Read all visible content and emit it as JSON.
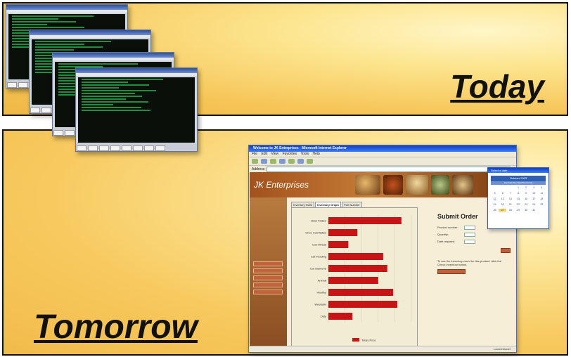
{
  "panels": {
    "top_label": "Today",
    "bottom_label": "Tomorrow"
  },
  "colors": {
    "panel_gold": "#f6c558",
    "terminal_text": "#1f8f3f",
    "bar_red": "#c81414",
    "banner_brown": "#a2521c"
  },
  "browser": {
    "window_title": "Welcome to JK Enterprises - Microsoft Internet Explorer",
    "menu": "File Edit View Favorites Tools Help",
    "address_label": "Address",
    "site_title": "JK Enterprises",
    "tabs": [
      "Inventory Table",
      "Inventory Graph",
      "Part Number"
    ],
    "form": {
      "heading": "Submit Order",
      "product_label": "Product number:",
      "quantity_label": "Quantity:",
      "date_label": "Date required:",
      "note": "To see the inventory count for this product, click the Check Inventory button."
    },
    "status_right": "Local intranet"
  },
  "datepicker": {
    "title": "Select a date...",
    "month": "October 2003",
    "weekdays": [
      "Sun",
      "Mon",
      "Tue",
      "Wed",
      "Thu",
      "Fri",
      "Sat"
    ],
    "days": [
      "",
      "",
      "",
      "1",
      "2",
      "3",
      "4",
      "5",
      "6",
      "7",
      "8",
      "9",
      "10",
      "11",
      "12",
      "13",
      "14",
      "15",
      "16",
      "17",
      "18",
      "19",
      "20",
      "21",
      "22",
      "23",
      "24",
      "25",
      "26",
      "27",
      "28",
      "29",
      "30",
      "31"
    ],
    "selected_day": "27"
  },
  "chart_data": {
    "type": "bar",
    "orientation": "horizontal",
    "categories": [
      "Bran Flakes",
      "Choc Cornflakes",
      "Cob Wheat",
      "Cat Pudding",
      "Cat Stamena",
      "Animal",
      "Healthy",
      "Weetabix",
      "Oaty"
    ],
    "values": [
      88,
      35,
      24,
      66,
      71,
      60,
      78,
      83,
      29
    ],
    "legend": [
      "Totals Price"
    ],
    "bar_color": "#c81414",
    "grid": true,
    "legend_position": "bottom"
  }
}
